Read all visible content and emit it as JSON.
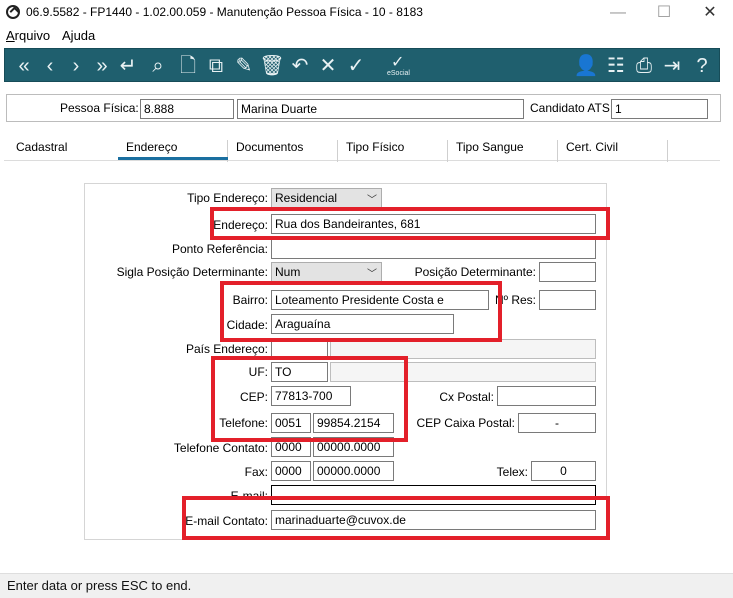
{
  "window": {
    "title": "06.9.5582 - FP1440 - 1.02.00.059 - Manutenção Pessoa Física - 10 - 8183",
    "minimize": "—",
    "maximize": "☐",
    "close": "✕"
  },
  "menu": {
    "items": [
      {
        "label": "Arquivo",
        "accel_index": 0
      },
      {
        "label": "Ajuda",
        "accel_index": 1
      }
    ]
  },
  "toolbar": {
    "buttons": [
      {
        "name": "first-record-icon",
        "glyph": "«"
      },
      {
        "name": "previous-record-icon",
        "glyph": "‹"
      },
      {
        "name": "next-record-icon",
        "glyph": "›"
      },
      {
        "name": "last-record-icon",
        "glyph": "»"
      },
      {
        "name": "return-icon",
        "glyph": "↵"
      },
      {
        "name": "search-icon",
        "glyph": "⌕"
      },
      {
        "name": "new-document-icon",
        "glyph": "🗋"
      },
      {
        "name": "copy-icon",
        "glyph": "⧉"
      },
      {
        "name": "edit-document-icon",
        "glyph": "✎"
      },
      {
        "name": "delete-icon",
        "glyph": "🗑"
      },
      {
        "name": "undo-icon",
        "glyph": "↶"
      },
      {
        "name": "cancel-icon",
        "glyph": "✕"
      },
      {
        "name": "confirm-icon",
        "glyph": "✓"
      }
    ],
    "esocial_label": "eSocial",
    "right_buttons": [
      {
        "name": "user-icon",
        "glyph": "👤"
      },
      {
        "name": "tree-icon",
        "glyph": "☷"
      },
      {
        "name": "print-icon",
        "glyph": "⎙"
      },
      {
        "name": "exit-icon",
        "glyph": "⇥"
      },
      {
        "name": "help-icon",
        "glyph": "?"
      }
    ]
  },
  "header": {
    "pessoa_fisica_label": "Pessoa Física:",
    "pessoa_fisica_code": "8.888",
    "pessoa_fisica_name": "Marina Duarte",
    "candidato_label": "Candidato ATS:",
    "candidato_value": "1"
  },
  "tabs": [
    "Cadastral",
    "Endereço",
    "Documentos",
    "Tipo Físico",
    "Tipo Sangue",
    "Cert. Civil"
  ],
  "active_tab": "Endereço",
  "form": {
    "tipo_endereco_label": "Tipo Endereço:",
    "tipo_endereco_value": "Residencial",
    "endereco_label": "Endereço:",
    "endereco_value": "Rua dos Bandeirantes, 681",
    "ponto_referencia_label": "Ponto Referência:",
    "ponto_referencia_value": "",
    "sigla_posicao_label": "Sigla Posição Determinante:",
    "sigla_posicao_value": "Num",
    "posicao_det_label": "Posição Determinante:",
    "posicao_det_value": "",
    "bairro_label": "Bairro:",
    "bairro_value": "Loteamento Presidente Costa e",
    "nres_label": "Nº Res:",
    "nres_value": "",
    "cidade_label": "Cidade:",
    "cidade_value": "Araguaína",
    "pais_label": "País Endereço:",
    "pais_value": "",
    "uf_label": "UF:",
    "uf_value": "TO",
    "cep_label": "CEP:",
    "cep_value": "77813-700",
    "cx_postal_label": "Cx Postal:",
    "cx_postal_value": "",
    "telefone_label": "Telefone:",
    "telefone_ddd": "0051",
    "telefone_num": "99854.2154",
    "cep_cx_label": "CEP Caixa Postal:",
    "cep_cx_value": "-",
    "tel_contato_label": "Telefone Contato:",
    "tel_contato_ddd": "0000",
    "tel_contato_num": "00000.0000",
    "fax_label": "Fax:",
    "fax_ddd": "0000",
    "fax_num": "00000.0000",
    "telex_label": "Telex:",
    "telex_value": "0",
    "email_label": "E-mail:",
    "email_value": "",
    "email_contato_label": "E-mail Contato:",
    "email_contato_value": "marinaduarte@cuvox.de"
  },
  "status": {
    "text": "Enter data or press ESC to end."
  },
  "colors": {
    "toolbar_bg": "#1f5f6e",
    "highlight": "#e3202a",
    "tab_active": "#1a6fa0"
  }
}
